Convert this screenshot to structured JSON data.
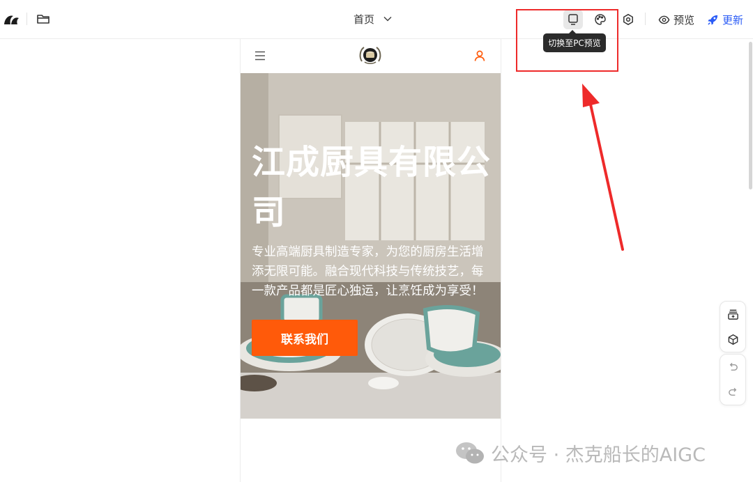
{
  "toolbar": {
    "page_selector": "首页",
    "tooltip": "切换至PC预览",
    "preview_label": "预览",
    "update_label": "更新"
  },
  "mobile_site": {
    "hero_title": "江成厨具有限公司",
    "hero_subtitle": "专业高端厨具制造专家，为您的厨房生活增添无限可能。融合现代科技与传统技艺，每一款产品都是匠心独运，让烹饪成为享受！",
    "cta_label": "联系我们"
  },
  "watermark": {
    "text": "公众号 · 杰克船长的AIGC"
  },
  "icons": {
    "toolbar_left": [
      "app-logo-icon",
      "folder-icon"
    ],
    "toolbar_right": [
      "monitor-icon",
      "palette-icon",
      "settings-icon",
      "eye-icon",
      "rocket-icon"
    ],
    "floating": [
      "add-component-icon",
      "cube-icon",
      "undo-icon",
      "redo-icon"
    ]
  },
  "colors": {
    "accent_orange": "#ff5a0a",
    "update_blue": "#2b5cf6",
    "highlight_red": "#ee2a2a",
    "tooltip_bg": "#2b2b2b"
  }
}
